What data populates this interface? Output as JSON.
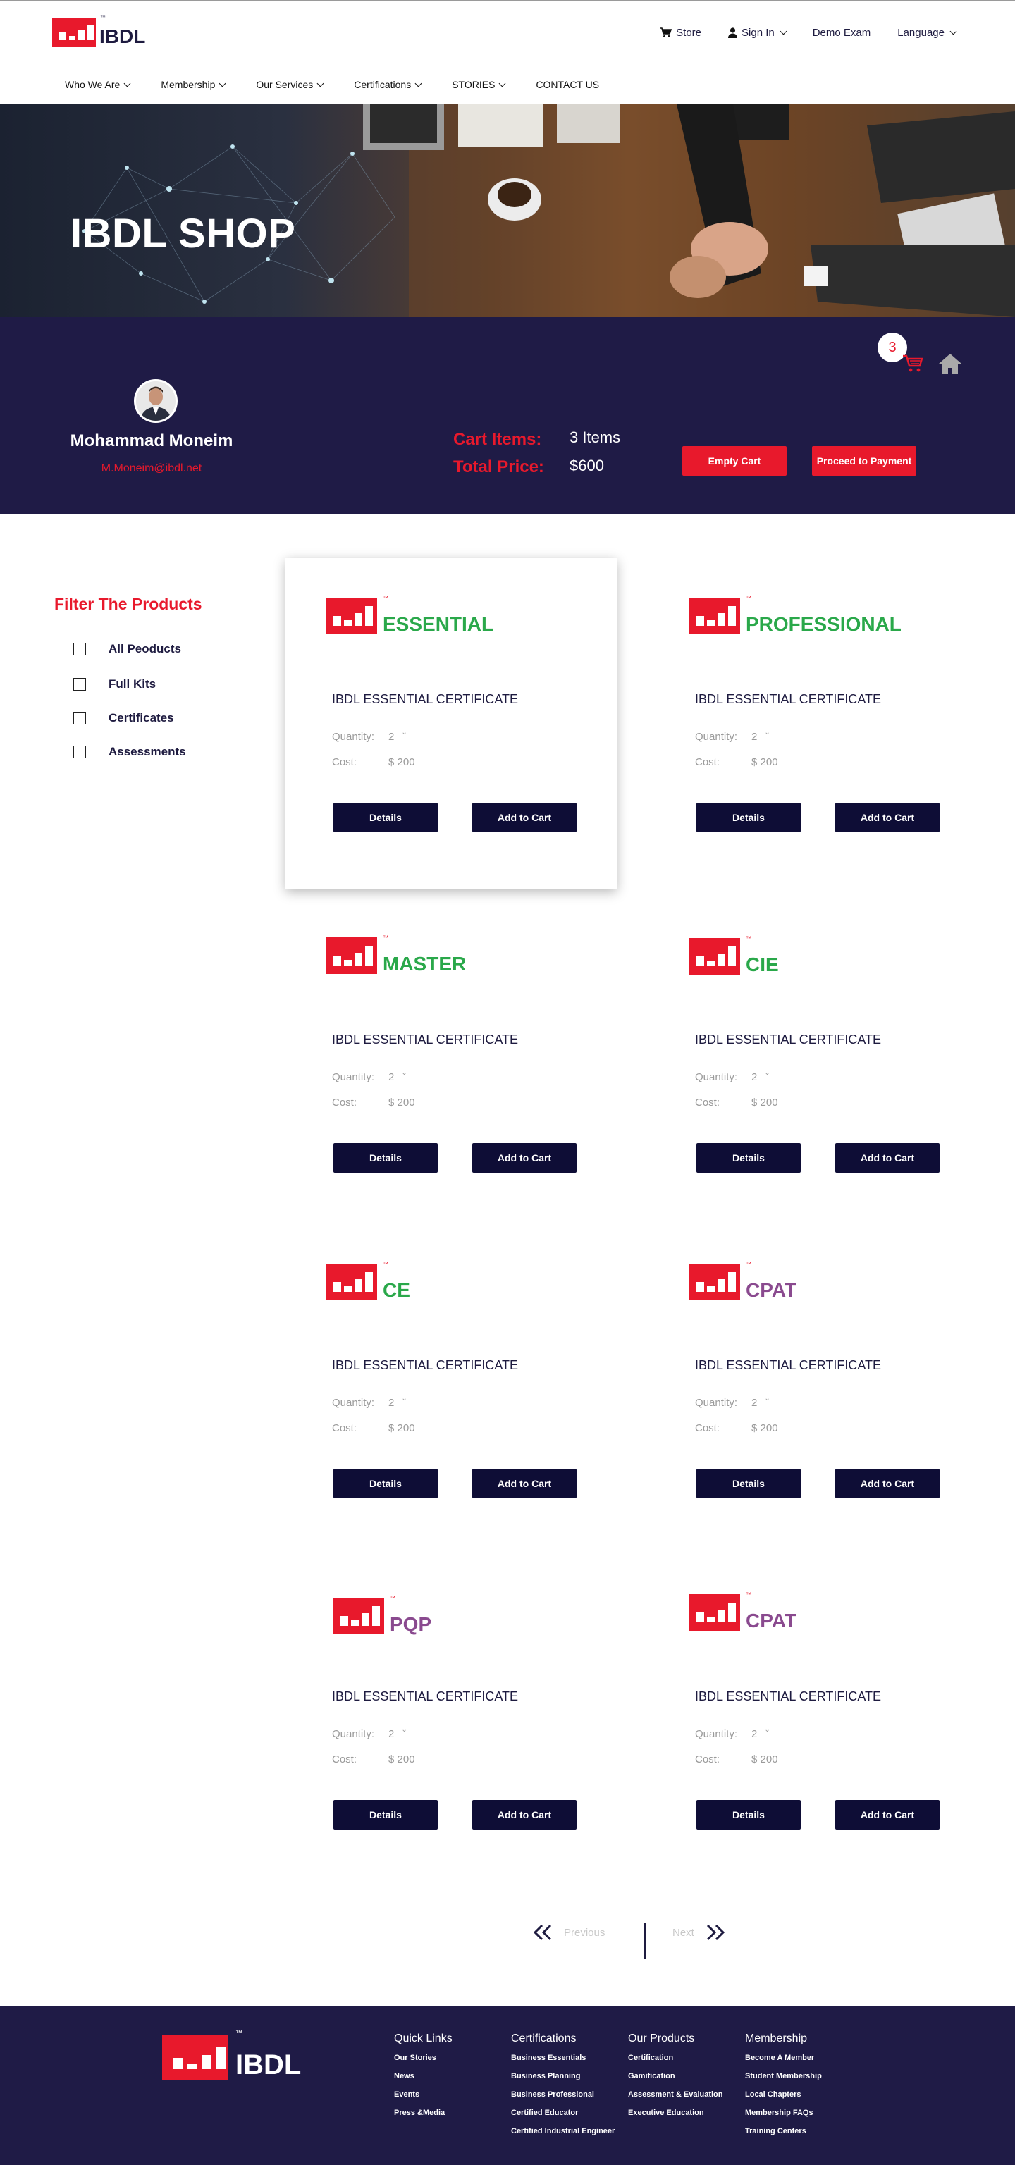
{
  "brand": {
    "name": "IBDL",
    "tm": "™",
    "accent": "#e8192c",
    "navy": "#1f1b46"
  },
  "topbar": {
    "store": "Store",
    "sign_in": "Sign In",
    "demo_exam": "Demo Exam",
    "language": "Language"
  },
  "nav": [
    "Who We Are",
    "Membership",
    "Our Services",
    "Certifications",
    "STORIES",
    "CONTACT US"
  ],
  "hero": {
    "title": "IBDL SHOP"
  },
  "profile": {
    "name": "Mohammad Moneim",
    "email": "M.Moneim@ibdl.net",
    "cart_items_label": "Cart Items:",
    "cart_items_value": "3 Items",
    "total_price_label": "Total Price:",
    "total_price_value": "$600",
    "empty_cart": "Empty Cart",
    "proceed": "Proceed to Payment",
    "cart_count": "3"
  },
  "filters": {
    "title": "Filter The Products",
    "items": [
      "All Peoducts",
      "Full Kits",
      "Certificates",
      "Assessments"
    ]
  },
  "products": [
    {
      "name": "ESSENTIAL",
      "color": "#2aa84a",
      "title": "IBDL ESSENTIAL CERTIFICATE",
      "qty_label": "Quantity:",
      "qty": "2",
      "cost_label": "Cost:",
      "cost": "$ 200",
      "details": "Details",
      "add": "Add to Cart"
    },
    {
      "name": "PROFESSIONAL",
      "color": "#2aa84a",
      "title": "IBDL ESSENTIAL CERTIFICATE",
      "qty_label": "Quantity:",
      "qty": "2",
      "cost_label": "Cost:",
      "cost": "$ 200",
      "details": "Details",
      "add": "Add to Cart"
    },
    {
      "name": "MASTER",
      "color": "#2aa84a",
      "title": "IBDL ESSENTIAL CERTIFICATE",
      "qty_label": "Quantity:",
      "qty": "2",
      "cost_label": "Cost:",
      "cost": "$ 200",
      "details": "Details",
      "add": "Add to Cart"
    },
    {
      "name": "CIE",
      "color": "#2aa84a",
      "title": "IBDL ESSENTIAL CERTIFICATE",
      "qty_label": "Quantity:",
      "qty": "2",
      "cost_label": "Cost:",
      "cost": "$ 200",
      "details": "Details",
      "add": "Add to Cart"
    },
    {
      "name": "CE",
      "color": "#2aa84a",
      "title": "IBDL ESSENTIAL CERTIFICATE",
      "qty_label": "Quantity:",
      "qty": "2",
      "cost_label": "Cost:",
      "cost": "$ 200",
      "details": "Details",
      "add": "Add to Cart"
    },
    {
      "name": "CPAT",
      "color": "#8a4a8f",
      "title": "IBDL ESSENTIAL CERTIFICATE",
      "qty_label": "Quantity:",
      "qty": "2",
      "cost_label": "Cost:",
      "cost": "$ 200",
      "details": "Details",
      "add": "Add to Cart"
    },
    {
      "name": "PQP",
      "color": "#8a4a8f",
      "title": "IBDL ESSENTIAL CERTIFICATE",
      "qty_label": "Quantity:",
      "qty": "2",
      "cost_label": "Cost:",
      "cost": "$ 200",
      "details": "Details",
      "add": "Add to Cart"
    },
    {
      "name": "CPAT",
      "color": "#8a4a8f",
      "title": "IBDL ESSENTIAL CERTIFICATE",
      "qty_label": "Quantity:",
      "qty": "2",
      "cost_label": "Cost:",
      "cost": "$ 200",
      "details": "Details",
      "add": "Add to Cart"
    }
  ],
  "pagination": {
    "previous": "Previous",
    "next": "Next"
  },
  "footer": {
    "columns": [
      {
        "title": "Quick Links",
        "links": [
          "Our Stories",
          "News",
          "Events",
          "Press &Media"
        ]
      },
      {
        "title": "Certifications",
        "links": [
          "Business Essentials",
          "Business Planning",
          "Business Professional",
          "Certified Educator",
          "Certified Industrial Engineer"
        ]
      },
      {
        "title": "Our Products",
        "links": [
          "Certification",
          "Gamification",
          "Assessment & Evaluation",
          "Executive Education"
        ]
      },
      {
        "title": "Membership",
        "links": [
          "Become A Member",
          "Student Membership",
          "Local Chapters",
          "Membership FAQs",
          "Training Centers"
        ]
      }
    ]
  }
}
